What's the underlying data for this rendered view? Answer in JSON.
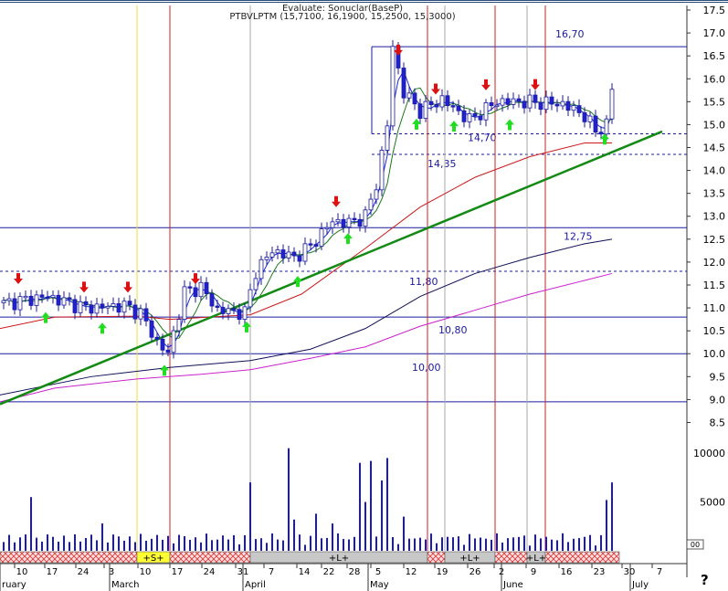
{
  "chart_data": {
    "type": "candlestick",
    "header_lines": [
      "Evaluate: Sonuclar(BaseP)",
      "PTBVLPTM (15,7100, 16,1900, 15,2500, 15,3000)"
    ],
    "y_axis": {
      "range": [
        8.35,
        17.6
      ],
      "ticks": [
        "17.5",
        "17.0",
        "16.5",
        "16.0",
        "15.5",
        "15.0",
        "14.5",
        "14.0",
        "13.5",
        "13.0",
        "12.5",
        "12.0",
        "11.5",
        "11.0",
        "10.5",
        "10.0",
        "9.5",
        "9.0",
        "8.5"
      ]
    },
    "volume_axis": {
      "range": [
        0,
        11500
      ],
      "ticks": [
        "10000",
        "5000"
      ],
      "label_00": "00"
    },
    "date_ticks": [
      "10",
      "17",
      "24",
      "3",
      "10",
      "17",
      "24",
      "31",
      "7",
      "14",
      "22",
      "28",
      "5",
      "12",
      "19",
      "26",
      "2",
      "9",
      "16",
      "23",
      "30",
      "7"
    ],
    "month_labels": [
      "ruary",
      "March",
      "April",
      "May",
      "June",
      "July"
    ],
    "levels": [
      {
        "value": 16.7,
        "label": "16,70",
        "style": "solid"
      },
      {
        "value": 14.8,
        "label": "",
        "style": "dashed"
      },
      {
        "value": 14.35,
        "label": "14,35",
        "style": "dashed"
      },
      {
        "value": 14.7,
        "label": "14,70",
        "style": "label"
      },
      {
        "value": 12.75,
        "label": "12,75",
        "style": "solid"
      },
      {
        "value": 11.8,
        "label": "11,80",
        "style": "dashed"
      },
      {
        "value": 10.8,
        "label": "10,80",
        "style": "solid"
      },
      {
        "value": 10.0,
        "label": "10,00",
        "style": "solid"
      },
      {
        "value": 8.95,
        "label": "",
        "style": "solid"
      }
    ],
    "trendline": {
      "from": [
        0,
        8.9
      ],
      "to": [
        725,
        14.85
      ],
      "color": "#138a13"
    },
    "signal_bar": {
      "segments": [
        {
          "from": 0,
          "to": 150,
          "label": "",
          "style": "hatch"
        },
        {
          "from": 150,
          "to": 186,
          "label": "+S+",
          "style": "yellow"
        },
        {
          "from": 186,
          "to": 274,
          "label": "",
          "style": "hatch"
        },
        {
          "from": 274,
          "to": 468,
          "label": "+L+",
          "style": "gray"
        },
        {
          "from": 468,
          "to": 487,
          "label": "",
          "style": "hatch"
        },
        {
          "from": 487,
          "to": 542,
          "label": "+L+",
          "style": "gray"
        },
        {
          "from": 542,
          "to": 577,
          "label": "",
          "style": "hatch"
        },
        {
          "from": 577,
          "to": 597,
          "label": "+L+",
          "style": "gray"
        },
        {
          "from": 597,
          "to": 678,
          "label": "",
          "style": "hatch"
        }
      ]
    },
    "colors": {
      "up": "#2222cc",
      "down": "#2222cc",
      "frame": "#1a1aa0",
      "ma_fast": "#1a2ad0",
      "ma_green": "#1a7a1a",
      "ma_red": "#cc1a1a",
      "ma_navy": "#10105a",
      "ma_magenta": "#cc22cc",
      "arrow_up": "#22dd22",
      "arrow_down": "#dd1111",
      "vline": "#cc2222",
      "vline_gray": "#aaaaaa"
    }
  }
}
